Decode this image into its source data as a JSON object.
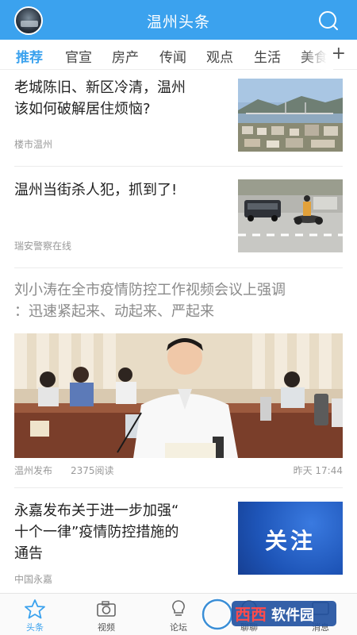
{
  "header": {
    "title": "温州头条"
  },
  "tabs": [
    "推荐",
    "官宣",
    "房产",
    "传闻",
    "观点",
    "生活",
    "美食"
  ],
  "articles": [
    {
      "title_line1": "老城陈旧、新区冷清，温州",
      "title_line2": "该如何破解居住烦恼?",
      "source": "楼市温州"
    },
    {
      "title": "温州当街杀人犯，抓到了!",
      "source": "瑞安警察在线"
    },
    {
      "title_line1": "刘小涛在全市疫情防控工作视频会议上强调",
      "title_line2": "：迅速紧起来、动起来、严起来",
      "source": "温州发布",
      "reads": "2375阅读",
      "time": "昨天 17:44"
    },
    {
      "title_line1": "永嘉发布关于进一步加强“",
      "title_line2": "十个一律”疫情防控措施的",
      "title_line3": "通告",
      "source": "中国永嘉",
      "thumb_text": "关注"
    }
  ],
  "bottom_nav": [
    {
      "label": "头条",
      "icon": "star-icon"
    },
    {
      "label": "视频",
      "icon": "camera-icon"
    },
    {
      "label": "论坛",
      "icon": "bulb-icon"
    },
    {
      "label": "聊聊",
      "icon": "chat-icon"
    },
    {
      "label": "消息",
      "icon": "message-icon"
    }
  ],
  "watermark": {
    "text": "西西软件园",
    "sub": "CR173.COM"
  },
  "colors": {
    "brand": "#3ba2ee",
    "gray_text": "#999999"
  }
}
